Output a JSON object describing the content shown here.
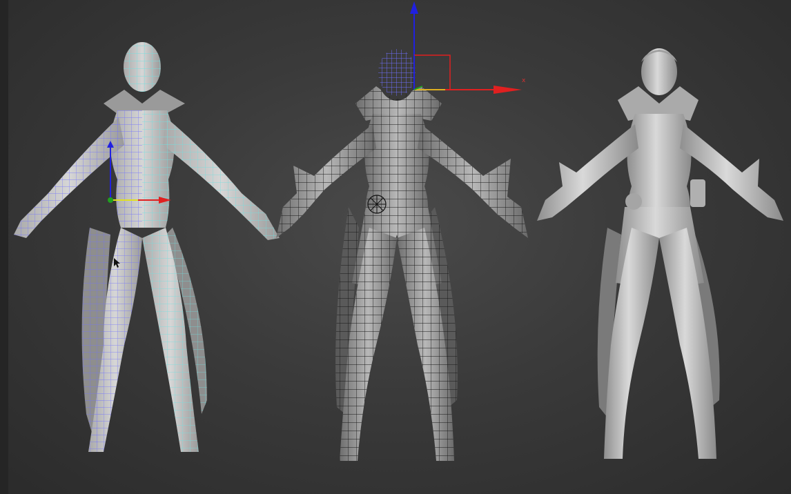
{
  "viewport": {
    "gizmo_axis_label": "x",
    "colors": {
      "background": "#3a3a3a",
      "wire_cyan": "#6fe0e0",
      "wire_blue": "#6c6cff",
      "wire_black": "#1a1a1a",
      "body_light": "#c8c8c8",
      "body_mid": "#8a8a8a",
      "gizmo_x": "#e02020",
      "gizmo_y": "#2020e0",
      "gizmo_z": "#20a020"
    }
  }
}
